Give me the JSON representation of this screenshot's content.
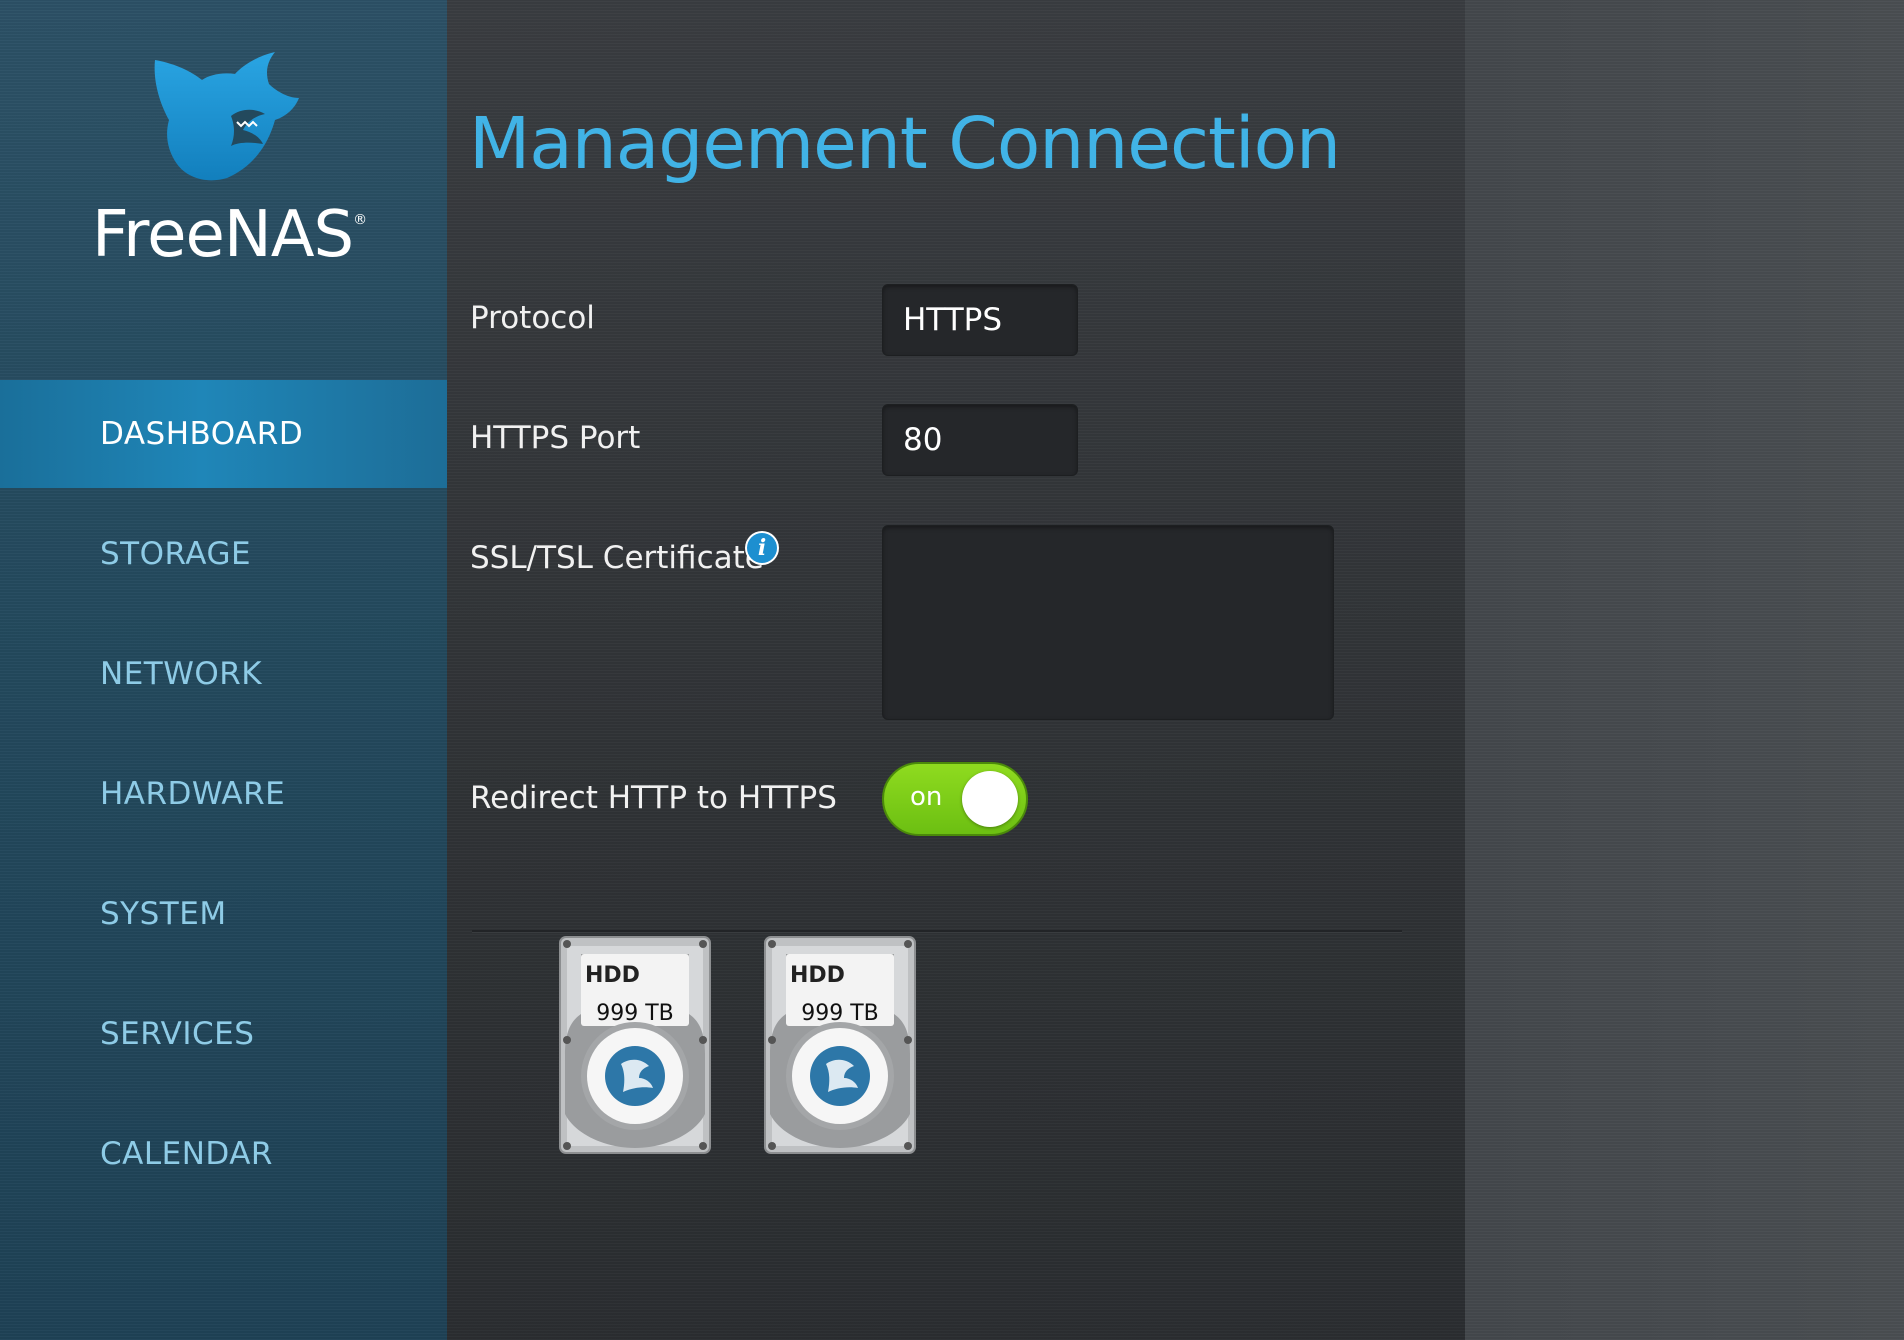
{
  "brand": {
    "name": "FreeNAS",
    "registered_mark": "®"
  },
  "sidebar": {
    "items": [
      {
        "label": "DASHBOARD",
        "active": true
      },
      {
        "label": "STORAGE",
        "active": false
      },
      {
        "label": "NETWORK",
        "active": false
      },
      {
        "label": "HARDWARE",
        "active": false
      },
      {
        "label": "SYSTEM",
        "active": false
      },
      {
        "label": "SERVICES",
        "active": false
      },
      {
        "label": "CALENDAR",
        "active": false
      }
    ]
  },
  "main": {
    "title": "Management Connection",
    "form": {
      "protocol_label": "Protocol",
      "protocol_value": "HTTPS",
      "port_label": "HTTPS Port",
      "port_value": "80",
      "certificate_label": "SSL/TSL Certificate",
      "certificate_value": "",
      "info_icon": "i",
      "redirect_label": "Redirect HTTP to HTTPS",
      "redirect_toggle_label": "on",
      "redirect_enabled": true
    },
    "drives": [
      {
        "type_label": "HDD",
        "capacity": "999 TB"
      },
      {
        "type_label": "HDD",
        "capacity": "999 TB"
      }
    ]
  },
  "colors": {
    "accent": "#41b3e6",
    "sidebar_active": "#1f86b8",
    "sidebar_text": "#8ecbe6",
    "toggle_on": "#7ccd18"
  },
  "icons": {
    "logo": "freenas-shark-icon",
    "info": "info-icon",
    "drive": "hdd-icon"
  }
}
